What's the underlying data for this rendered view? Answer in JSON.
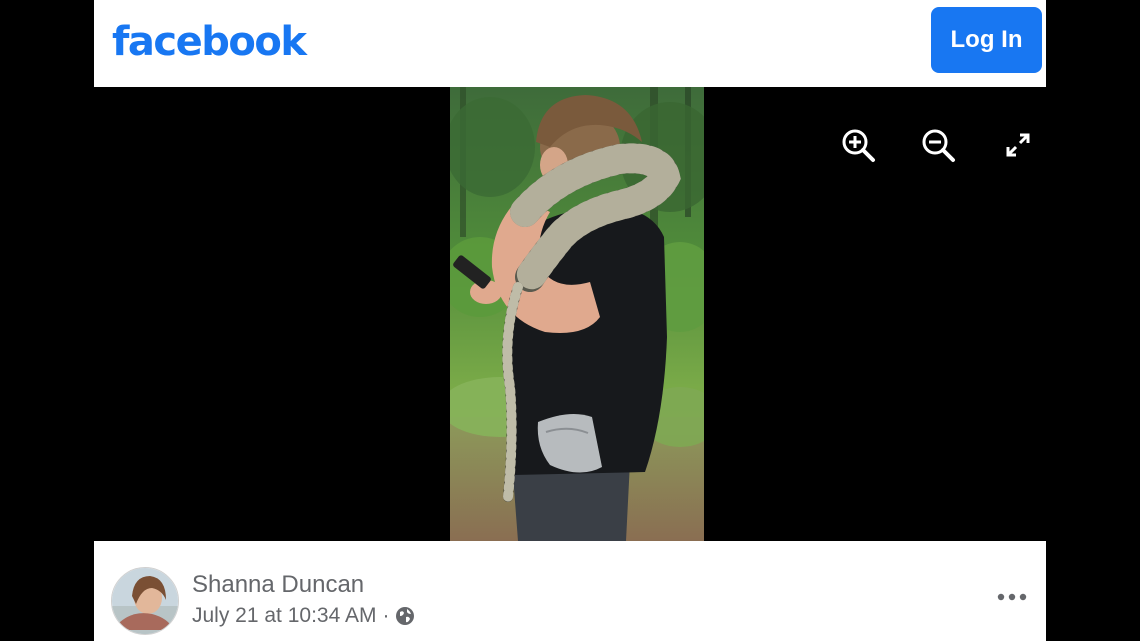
{
  "header": {
    "logo_text": "facebook",
    "login_label": "Log In"
  },
  "viewer": {
    "controls": [
      {
        "name": "zoom-in-icon"
      },
      {
        "name": "zoom-out-icon"
      },
      {
        "name": "fullscreen-icon"
      }
    ],
    "photo_description_icon": "photo"
  },
  "post": {
    "author": "Shanna Duncan",
    "timestamp": "July 21 at 10:34 AM",
    "separator": "·",
    "audience_icon": "globe-icon",
    "more_icon": "more-options-icon"
  },
  "colors": {
    "brand": "#1877f2",
    "meta_text": "#65676b",
    "viewer_bg": "#000000"
  }
}
